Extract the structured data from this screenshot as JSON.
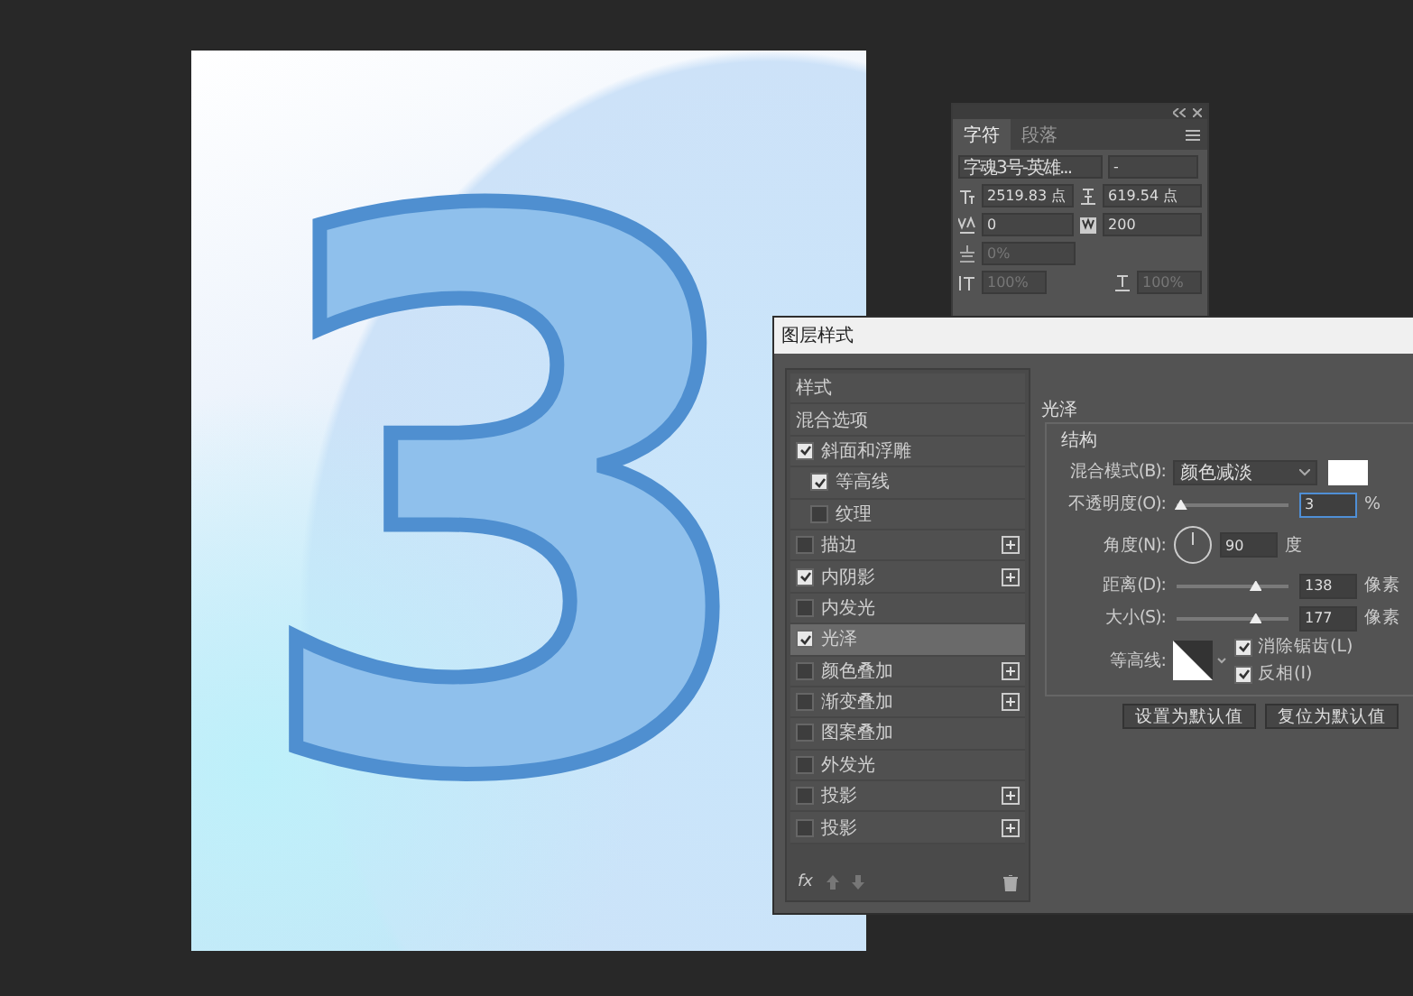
{
  "canvas": {
    "artwork_text": "3"
  },
  "character_panel": {
    "tabs": [
      {
        "label": "字符",
        "selected": true
      },
      {
        "label": "段落",
        "selected": false
      }
    ],
    "font_family": "字魂3号-英雄...",
    "font_style": "-",
    "font_size": "2519.83 点",
    "leading": "619.54 点",
    "kerning": "0",
    "tracking": "200",
    "tsume": "0%",
    "vertical_scale": "100%",
    "horizontal_scale": "100%"
  },
  "layer_style": {
    "title": "图层样式",
    "styles": [
      {
        "label": "样式",
        "kind": "header",
        "selected": false
      },
      {
        "label": "混合选项",
        "kind": "header",
        "selected": false
      },
      {
        "label": "斜面和浮雕",
        "kind": "option",
        "checked": true,
        "selected": false,
        "add": false,
        "children": [
          {
            "label": "等高线",
            "kind": "option",
            "checked": true,
            "selected": false,
            "add": false
          },
          {
            "label": "纹理",
            "kind": "option",
            "checked": false,
            "selected": false,
            "add": false
          }
        ]
      },
      {
        "label": "描边",
        "kind": "option",
        "checked": false,
        "selected": false,
        "add": true
      },
      {
        "label": "内阴影",
        "kind": "option",
        "checked": true,
        "selected": false,
        "add": true
      },
      {
        "label": "内发光",
        "kind": "option",
        "checked": false,
        "selected": false,
        "add": false
      },
      {
        "label": "光泽",
        "kind": "option",
        "checked": true,
        "selected": true,
        "add": false
      },
      {
        "label": "颜色叠加",
        "kind": "option",
        "checked": false,
        "selected": false,
        "add": true
      },
      {
        "label": "渐变叠加",
        "kind": "option",
        "checked": false,
        "selected": false,
        "add": true
      },
      {
        "label": "图案叠加",
        "kind": "option",
        "checked": false,
        "selected": false,
        "add": false
      },
      {
        "label": "外发光",
        "kind": "option",
        "checked": false,
        "selected": false,
        "add": false
      },
      {
        "label": "投影",
        "kind": "option",
        "checked": false,
        "selected": false,
        "add": true
      },
      {
        "label": "投影",
        "kind": "option",
        "checked": false,
        "selected": false,
        "add": true
      }
    ],
    "footer_label": "fx",
    "section_title": "光泽",
    "group_title": "结构",
    "blend_mode": {
      "label": "混合模式(B):",
      "value": "颜色减淡"
    },
    "opacity": {
      "label": "不透明度(O):",
      "value": "3",
      "unit": "%",
      "level": 0.03
    },
    "angle": {
      "label": "角度(N):",
      "value": "90",
      "unit": "度"
    },
    "distance": {
      "label": "距离(D):",
      "value": "138",
      "unit": "像素",
      "level": 0.7
    },
    "size": {
      "label": "大小(S):",
      "value": "177",
      "unit": "像素",
      "level": 0.7
    },
    "contour": {
      "label": "等高线:"
    },
    "checkboxes": [
      {
        "label": "消除锯齿(L)",
        "checked": true
      },
      {
        "label": "反相(I)",
        "checked": true
      }
    ],
    "buttons": [
      "设置为默认值",
      "复位为默认值"
    ]
  }
}
